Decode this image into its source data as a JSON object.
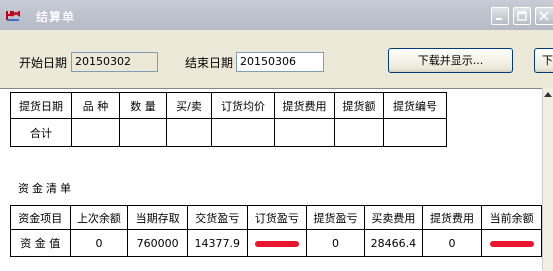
{
  "window": {
    "title": "结算单"
  },
  "toolbar": {
    "start_label": "开始日期",
    "start_value": "20150302",
    "end_label": "结束日期",
    "end_value": "20150306",
    "download_label": "下载并显示...",
    "partial_button_label": "下"
  },
  "delivery_table": {
    "headers": [
      "提货日期",
      "品  种",
      "数  量",
      "买/卖",
      "订货均价",
      "提货费用",
      "提货额",
      "提货编号"
    ],
    "total_label": "合计"
  },
  "funds": {
    "section_title": "资金清单",
    "headers": [
      "资金项目",
      "上次余额",
      "当期存取",
      "交货盈亏",
      "订货盈亏",
      "提货盈亏",
      "买卖费用",
      "提货费用",
      "当前余额"
    ],
    "row_label": "资 金 值",
    "values": [
      "0",
      "760000",
      "14377.9",
      "",
      "0",
      "28466.4",
      "0",
      ""
    ]
  },
  "colors": {
    "redaction": "#e8162c",
    "app_icon_red": "#c0001a"
  }
}
